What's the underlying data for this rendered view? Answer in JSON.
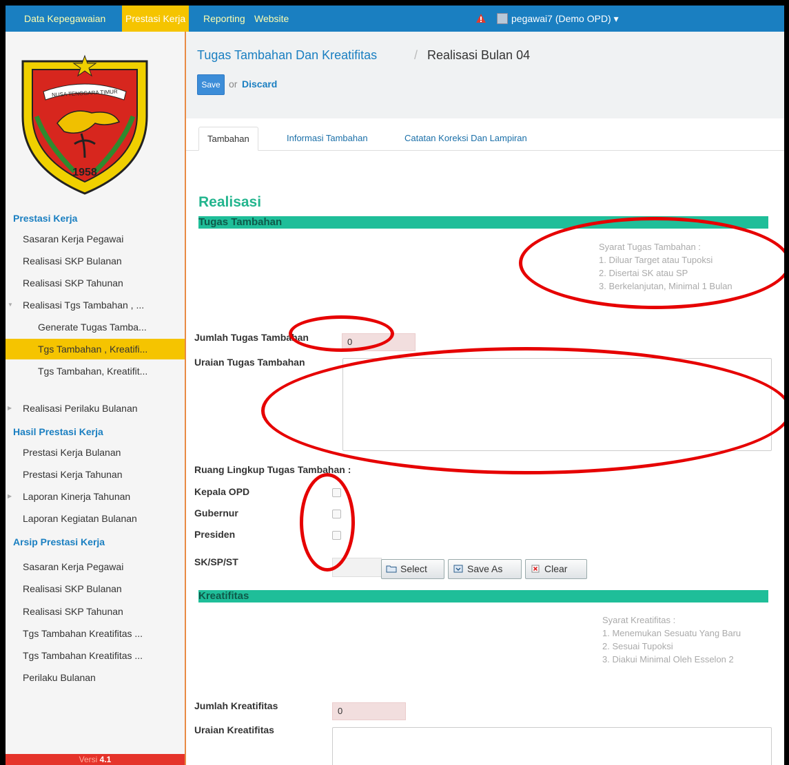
{
  "topnav": {
    "items": [
      {
        "label": "Data Kepegawaian",
        "active": false
      },
      {
        "label": "Prestasi Kerja",
        "active": true
      },
      {
        "label": "Reporting",
        "active": false
      },
      {
        "label": "Website",
        "active": false
      }
    ],
    "user": "pegawai7 (Demo OPD) ▾",
    "warning_icon": "warning-icon",
    "colors": {
      "bar": "#1a7fc1",
      "active": "#f5c400"
    }
  },
  "sidebar": {
    "logo": {
      "banner": "NUSA TENGGARA TIMUR",
      "year": "1958"
    },
    "sections": [
      {
        "title": "Prestasi Kerja",
        "items": [
          {
            "label": "Sasaran Kerja Pegawai"
          },
          {
            "label": "Realisasi SKP Bulanan"
          },
          {
            "label": "Realisasi SKP Tahunan"
          },
          {
            "label": "Realisasi Tgs Tambahan , ..."
          },
          {
            "label": "Generate Tugas Tamba..."
          },
          {
            "label": "Tgs Tambahan , Kreatifi..."
          },
          {
            "label": "Tgs Tambahan, Kreatifit..."
          },
          {
            "label": "Realisasi Perilaku Bulanan"
          }
        ]
      },
      {
        "title": "Hasil Prestasi Kerja",
        "items": [
          {
            "label": "Prestasi Kerja Bulanan"
          },
          {
            "label": "Prestasi Kerja Tahunan"
          },
          {
            "label": "Laporan Kinerja Tahunan"
          },
          {
            "label": "Laporan Kegiatan Bulanan"
          }
        ]
      },
      {
        "title": "Arsip Prestasi Kerja",
        "items": [
          {
            "label": "Sasaran Kerja Pegawai"
          },
          {
            "label": "Realisasi SKP Bulanan"
          },
          {
            "label": "Realisasi SKP Tahunan"
          },
          {
            "label": "Tgs Tambahan Kreatifitas ..."
          },
          {
            "label": "Tgs Tambahan Kreatifitas ..."
          },
          {
            "label": "Perilaku Bulanan"
          }
        ]
      }
    ],
    "version_label": "Versi",
    "version_number": "4.1"
  },
  "header": {
    "breadcrumb_link": "Tugas Tambahan Dan Kreatifitas",
    "breadcrumb_sep": "/",
    "breadcrumb_current": "Realisasi Bulan 04",
    "save_label": "Save",
    "or_text": "or",
    "discard_label": "Discard"
  },
  "tabs": [
    {
      "label": "Tambahan",
      "active": true
    },
    {
      "label": "Informasi Tambahan",
      "active": false
    },
    {
      "label": "Catatan Koreksi Dan Lampiran",
      "active": false
    }
  ],
  "form": {
    "title": "Realisasi",
    "tugas_tambahan": {
      "section_title": "Tugas Tambahan",
      "syarat_title": "Syarat Tugas Tambahan :",
      "syarat_items": [
        "1. Diluar Target atau Tupoksi",
        "2. Disertai SK atau SP",
        "3. Berkelanjutan, Minimal 1 Bulan"
      ],
      "jumlah_label": "Jumlah Tugas Tambahan",
      "jumlah_value": "0",
      "uraian_label": "Uraian Tugas Tambahan",
      "uraian_value": "",
      "ruang_lingkup_label": "Ruang Lingkup Tugas Tambahan :",
      "checkboxes": [
        {
          "label": "Kepala OPD",
          "checked": false
        },
        {
          "label": "Gubernur",
          "checked": false
        },
        {
          "label": "Presiden",
          "checked": false
        }
      ],
      "sk_label": "SK/SP/ST",
      "sk_value": "",
      "buttons": {
        "select": "Select",
        "save_as": "Save As",
        "clear": "Clear"
      }
    },
    "kreatifitas": {
      "section_title": "Kreatifitas",
      "syarat_title": "Syarat Kreatifitas :",
      "syarat_items": [
        "1. Menemukan Sesuatu Yang Baru",
        "2. Sesuai Tupoksi",
        "3. Diakui Minimal Oleh Esselon 2"
      ],
      "jumlah_label": "Jumlah Kreatifitas",
      "jumlah_value": "0",
      "uraian_label": "Uraian Kreatifitas",
      "uraian_value": ""
    }
  },
  "annotation_color": "#e60000"
}
